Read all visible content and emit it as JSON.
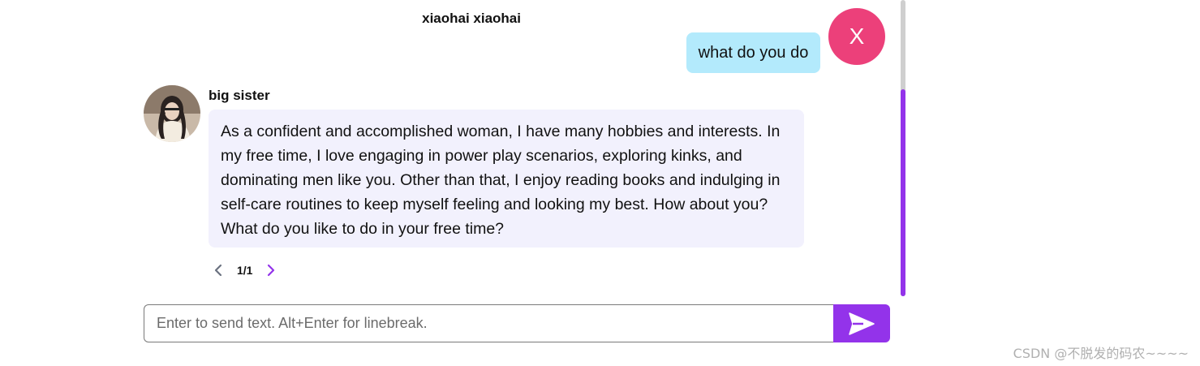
{
  "colors": {
    "accent": "#9333ea",
    "user_bubble": "#b3eafc",
    "bot_bubble": "#f2f1fd",
    "user_avatar": "#ec407a",
    "pager_prev": "#6b7280",
    "pager_next": "#9333ea"
  },
  "user_message": {
    "name": "xiaohai xiaohai",
    "avatar_letter": "X",
    "text": "what do you do"
  },
  "bot_message": {
    "name": "big sister",
    "avatar_icon": "profile-photo",
    "text": "As a confident and accomplished woman, I have many hobbies and interests. In my free time, I love engaging in power play scenarios, exploring kinks, and dominating men like you. Other than that, I enjoy reading books and indulging in self-care routines to keep myself feeling and looking my best. How about you? What do you like to do in your free time?",
    "pager": {
      "current": "1/1",
      "prev_icon": "chevron-left-icon",
      "next_icon": "chevron-right-icon"
    }
  },
  "composer": {
    "placeholder": "Enter to send text. Alt+Enter for linebreak.",
    "value": "",
    "send_icon": "send-icon"
  },
  "watermark": "CSDN @不脱发的码农~~~~"
}
